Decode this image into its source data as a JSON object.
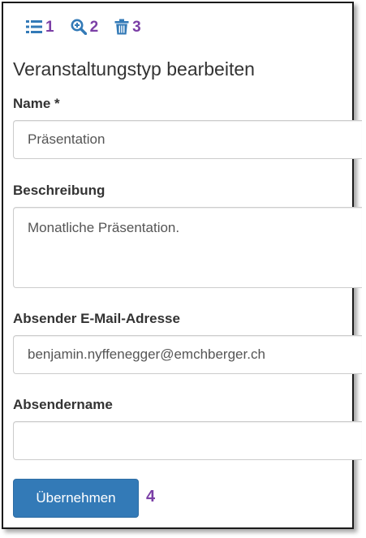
{
  "toolbar": {
    "items": [
      {
        "icon": "list-icon",
        "number": "1"
      },
      {
        "icon": "zoom-in-icon",
        "number": "2"
      },
      {
        "icon": "trash-icon",
        "number": "3"
      }
    ],
    "icon_color": "#337ab7",
    "number_color": "#7b3fa6"
  },
  "form": {
    "title": "Veranstaltungstyp bearbeiten",
    "name": {
      "label": "Name *",
      "value": "Präsentation"
    },
    "description": {
      "label": "Beschreibung",
      "value": "Monatliche Präsentation."
    },
    "sender_email": {
      "label": "Absender E-Mail-Adresse",
      "value": "benjamin.nyffenegger@emchberger.ch"
    },
    "sender_name": {
      "label": "Absendername",
      "value": ""
    },
    "submit_label": "Übernehmen",
    "submit_annotation": "4",
    "primary_color": "#337ab7"
  }
}
